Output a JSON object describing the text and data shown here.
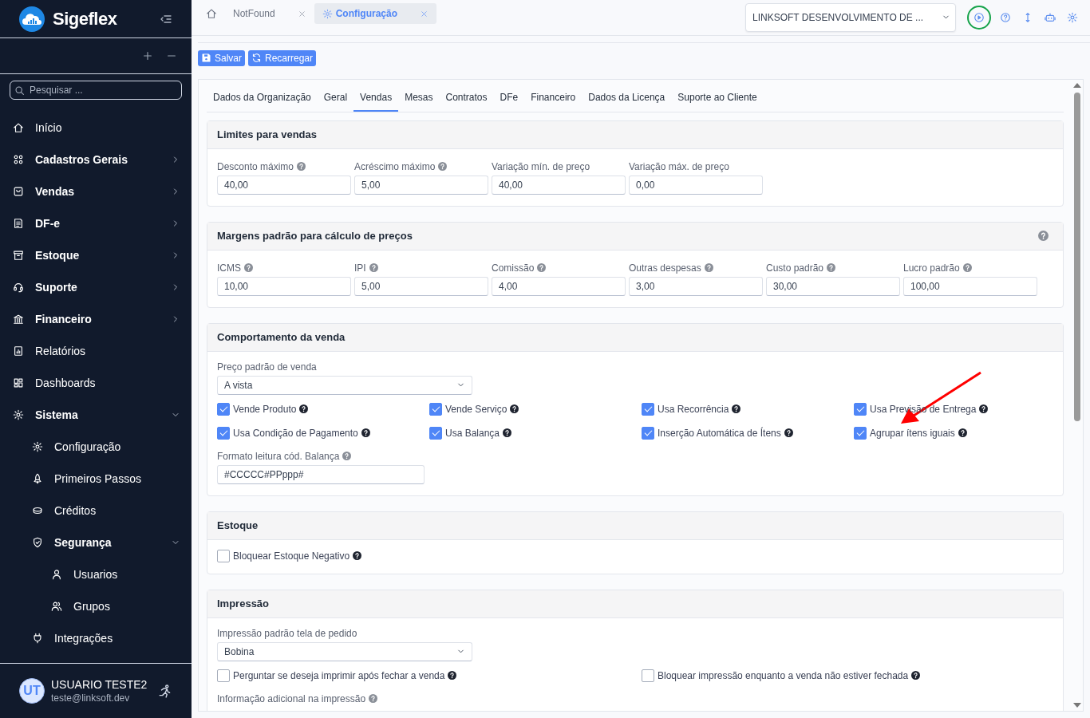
{
  "sidebar": {
    "brand": "Sigeflex",
    "search": {
      "placeholder": "Pesquisar ..."
    },
    "menu": [
      {
        "label": "Início"
      },
      {
        "label": "Cadastros Gerais",
        "expanded": false
      },
      {
        "label": "Vendas",
        "expanded": false
      },
      {
        "label": "DF-e",
        "expanded": false
      },
      {
        "label": "Estoque",
        "expanded": false
      },
      {
        "label": "Suporte",
        "expanded": false
      },
      {
        "label": "Financeiro",
        "expanded": false
      },
      {
        "label": "Relatórios"
      },
      {
        "label": "Dashboards"
      },
      {
        "label": "Sistema",
        "expanded": true,
        "children": [
          {
            "label": "Configuração"
          },
          {
            "label": "Primeiros Passos"
          },
          {
            "label": "Créditos"
          },
          {
            "label": "Segurança",
            "expanded": true,
            "children": [
              {
                "label": "Usuarios"
              },
              {
                "label": "Grupos"
              }
            ]
          },
          {
            "label": "Integrações"
          }
        ]
      }
    ],
    "user": {
      "initials": "UT",
      "name": "USUARIO TESTE2",
      "email": "teste@linksoft.dev"
    }
  },
  "topbar": {
    "tabs": [
      {
        "kind": "home",
        "selected": false
      },
      {
        "kind": "plain",
        "label": "NotFound",
        "selected": false
      },
      {
        "kind": "settings",
        "label": "Configuração",
        "selected": true
      }
    ],
    "company": "LINKSOFT DESENVOLVIMENTO DE ...",
    "icons": [
      {
        "kind": "play",
        "highlighted": true
      },
      {
        "kind": "help",
        "highlighted": false
      },
      {
        "kind": "resize",
        "highlighted": false
      },
      {
        "kind": "robot",
        "highlighted": false
      },
      {
        "kind": "settings",
        "highlighted": false
      }
    ]
  },
  "actions": [
    {
      "kind": "save",
      "label": "Salvar"
    },
    {
      "kind": "reload",
      "label": "Recarregar"
    }
  ],
  "config": {
    "tabs": [
      {
        "label": "Dados da Organização",
        "selected": false
      },
      {
        "label": "Geral",
        "selected": false
      },
      {
        "label": "Vendas",
        "selected": true
      },
      {
        "label": "Mesas",
        "selected": false
      },
      {
        "label": "Contratos",
        "selected": false
      },
      {
        "label": "DFe",
        "selected": false
      },
      {
        "label": "Financeiro",
        "selected": false
      },
      {
        "label": "Dados da Licença",
        "selected": false
      },
      {
        "label": "Suporte ao Cliente",
        "selected": false
      }
    ],
    "sections": [
      {
        "title": "Limites para vendas",
        "help": false,
        "rows": [
          {
            "kind": "fields",
            "items": [
              {
                "label": "Desconto máximo",
                "help": true,
                "value": "40,00"
              },
              {
                "label": "Acréscimo máximo",
                "help": true,
                "value": "5,00"
              },
              {
                "label": "Variação mín. de preço",
                "help": false,
                "value": "40,00"
              },
              {
                "label": "Variação máx. de preço",
                "help": false,
                "value": "0,00"
              }
            ]
          }
        ]
      },
      {
        "title": "Margens padrão para cálculo de preços",
        "help": true,
        "rows": [
          {
            "kind": "fields",
            "items": [
              {
                "label": "ICMS",
                "help": true,
                "value": "10,00"
              },
              {
                "label": "IPI",
                "help": true,
                "value": "5,00"
              },
              {
                "label": "Comissão",
                "help": true,
                "value": "4,00"
              },
              {
                "label": "Outras despesas",
                "help": true,
                "value": "3,00"
              },
              {
                "label": "Custo padrão",
                "help": true,
                "value": "30,00"
              },
              {
                "label": "Lucro padrão",
                "help": true,
                "value": "100,00"
              }
            ]
          }
        ]
      },
      {
        "title": "Comportamento da venda",
        "help": false,
        "rows": [
          {
            "kind": "select",
            "label": "Preço padrão de venda",
            "value": "A vista"
          },
          {
            "kind": "checks",
            "items": [
              {
                "label": "Vende Produto",
                "checked": true,
                "pointed": false
              },
              {
                "label": "Vende Serviço",
                "checked": true,
                "pointed": false
              },
              {
                "label": "Usa Recorrência",
                "checked": true,
                "pointed": false
              },
              {
                "label": "Usa Previsão de Entrega",
                "checked": true,
                "pointed": false
              },
              {
                "label": "Usa Condição de Pagamento",
                "checked": true,
                "pointed": false
              },
              {
                "label": "Usa Balança",
                "checked": true,
                "pointed": false
              },
              {
                "label": "Inserção Automática de Ítens",
                "checked": true,
                "pointed": false
              },
              {
                "label": "Agrupar ítens iguais",
                "checked": true,
                "pointed": true
              }
            ]
          },
          {
            "kind": "input",
            "label": "Formato leitura cód. Balança",
            "help": true,
            "value": "#CCCCC#PPppp#"
          }
        ]
      },
      {
        "title": "Estoque",
        "help": false,
        "rows": [
          {
            "kind": "checks",
            "items": [
              {
                "label": "Bloquear Estoque Negativo",
                "checked": false
              }
            ]
          }
        ]
      },
      {
        "title": "Impressão",
        "help": false,
        "rows": [
          {
            "kind": "select",
            "label": "Impressão padrão tela de pedido",
            "value": "Bobina"
          },
          {
            "kind": "wide-checks",
            "items": [
              {
                "label": "Perguntar se deseja imprimir após fechar a venda",
                "checked": false
              },
              {
                "label": "Bloquear impressão enquanto a venda não estiver fechada",
                "checked": false
              }
            ]
          },
          {
            "kind": "label",
            "label": "Informação adicional na impressão",
            "help": true
          }
        ]
      }
    ]
  }
}
